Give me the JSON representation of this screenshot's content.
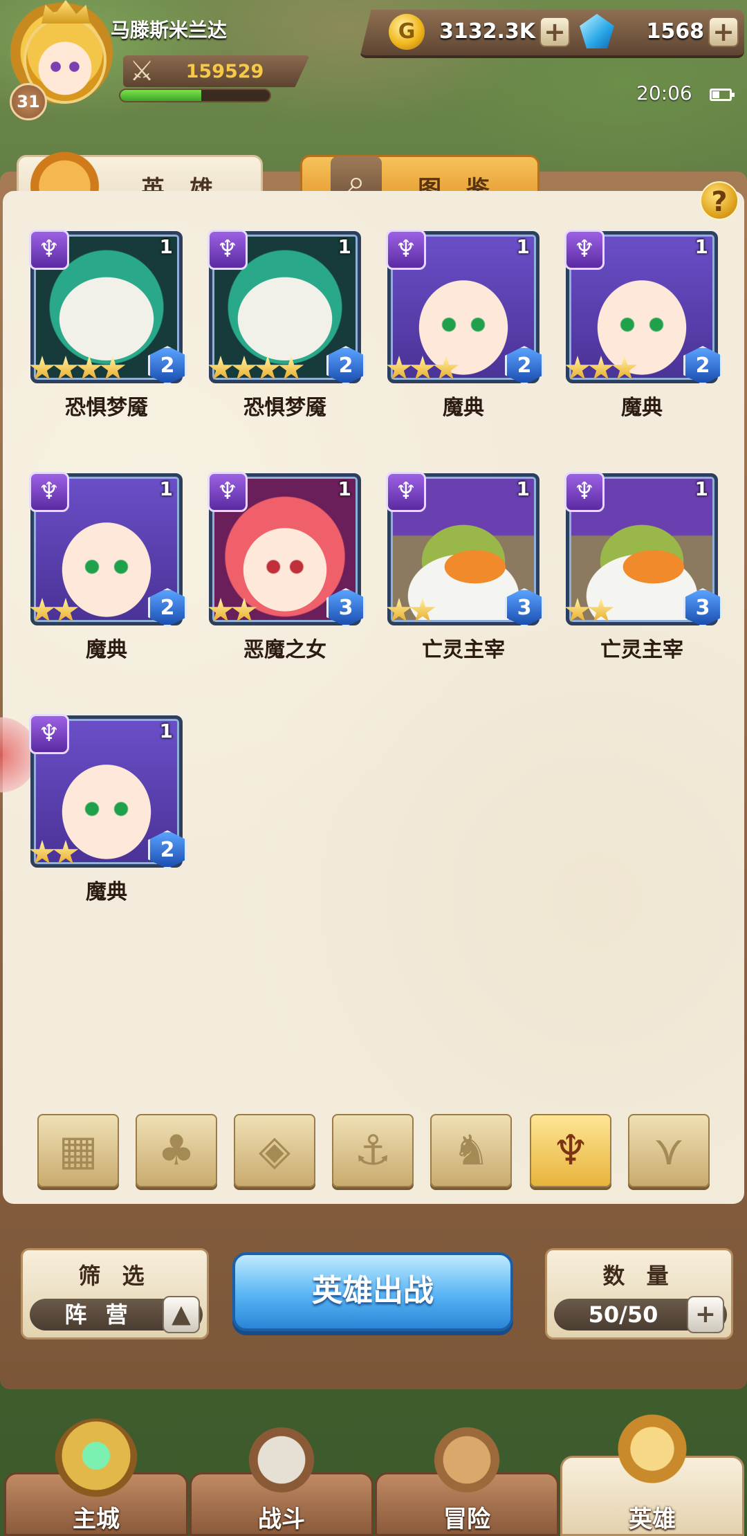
{
  "player": {
    "name": "马滕斯米兰达",
    "level": "31",
    "power": "159529",
    "xp_fraction": 0.54
  },
  "resources": {
    "gold": "3132.3K",
    "gems": "1568"
  },
  "status": {
    "time": "20:06"
  },
  "tabs": {
    "heroes": "英 雄",
    "codex": "图 鉴"
  },
  "heroes": [
    {
      "name": "恐惧梦魇",
      "level": "1",
      "stars": 4,
      "grade": "2",
      "portrait": "masked-jester"
    },
    {
      "name": "恐惧梦魇",
      "level": "1",
      "stars": 4,
      "grade": "2",
      "portrait": "masked-jester"
    },
    {
      "name": "魔典",
      "level": "1",
      "stars": 3,
      "grade": "2",
      "portrait": "purple-hair-girl"
    },
    {
      "name": "魔典",
      "level": "1",
      "stars": 3,
      "grade": "2",
      "portrait": "purple-hair-girl"
    },
    {
      "name": "魔典",
      "level": "1",
      "stars": 2,
      "grade": "2",
      "portrait": "purple-hair-girl"
    },
    {
      "name": "恶魔之女",
      "level": "1",
      "stars": 2,
      "grade": "3",
      "portrait": "red-hair-girl"
    },
    {
      "name": "亡灵主宰",
      "level": "1",
      "stars": 2,
      "grade": "3",
      "portrait": "bird-wizard"
    },
    {
      "name": "亡灵主宰",
      "level": "1",
      "stars": 2,
      "grade": "3",
      "portrait": "bird-wizard"
    },
    {
      "name": "魔典",
      "level": "1",
      "stars": 2,
      "grade": "2",
      "portrait": "purple-hair-girl"
    }
  ],
  "faction_filters": [
    {
      "id": "all",
      "icon": "grid-icon",
      "active": false
    },
    {
      "id": "nature",
      "icon": "leaf-icon",
      "active": false
    },
    {
      "id": "order",
      "icon": "diamond-icon",
      "active": false
    },
    {
      "id": "sea",
      "icon": "anchor-icon",
      "active": false
    },
    {
      "id": "beast",
      "icon": "beast-icon",
      "active": false
    },
    {
      "id": "demon",
      "icon": "demon-horns-icon",
      "active": true
    },
    {
      "id": "wing",
      "icon": "wing-icon",
      "active": false
    }
  ],
  "controls": {
    "filter_title": "筛 选",
    "filter_value": "阵 营",
    "deploy_label": "英雄出战",
    "count_title": "数 量",
    "count_value": "50/50"
  },
  "nav": [
    {
      "label": "主城",
      "icon": "castle-icon",
      "active": false
    },
    {
      "label": "战斗",
      "icon": "crossed-swords-icon",
      "active": false
    },
    {
      "label": "冒险",
      "icon": "map-scroll-icon",
      "active": false
    },
    {
      "label": "英雄",
      "icon": "hero-helmet-icon",
      "active": true
    }
  ],
  "colors": {
    "faction_purple": "#7a3fc8",
    "deploy_blue": "#58b4f4",
    "gold_text": "#f7c948"
  }
}
